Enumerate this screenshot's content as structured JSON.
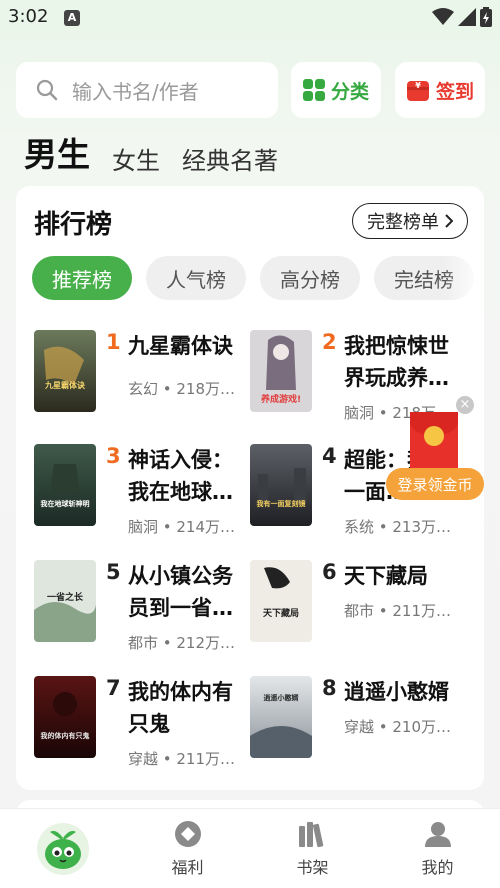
{
  "status_bar": {
    "time": "3:02",
    "notif_letter": "A"
  },
  "search": {
    "placeholder": "输入书名/作者"
  },
  "top_buttons": {
    "category": "分类",
    "signin": "签到"
  },
  "gender_tabs": [
    {
      "label": "男生",
      "active": true
    },
    {
      "label": "女生",
      "active": false
    },
    {
      "label": "经典名著",
      "active": false
    }
  ],
  "ranking": {
    "title": "排行榜",
    "full_list": "完整榜单",
    "chips": [
      {
        "label": "推荐榜",
        "active": true
      },
      {
        "label": "人气榜",
        "active": false
      },
      {
        "label": "高分榜",
        "active": false
      },
      {
        "label": "完结榜",
        "active": false
      }
    ],
    "books": [
      {
        "rank": "1",
        "title": "九星霸体诀",
        "meta": "玄幻 • 218万…"
      },
      {
        "rank": "2",
        "title": "我把惊悚世界玩成养…",
        "meta": "脑洞 • 218万…"
      },
      {
        "rank": "3",
        "title": "神话入侵：我在地球…",
        "meta": "脑洞 • 214万…"
      },
      {
        "rank": "4",
        "title": "超能：我有一面…",
        "meta": "系统 • 213万…"
      },
      {
        "rank": "5",
        "title": "从小镇公务员到一省…",
        "meta": "都市 • 212万…"
      },
      {
        "rank": "6",
        "title": "天下藏局",
        "meta": "都市 • 211万…"
      },
      {
        "rank": "7",
        "title": "我的体内有只鬼",
        "meta": "穿越 • 211万…"
      },
      {
        "rank": "8",
        "title": "逍遥小憨婿",
        "meta": "穿越 • 210万…"
      }
    ],
    "cover_texts": [
      "九星霸体诀",
      "养成游戏!",
      "我在地球斩神明",
      "我有一面复刻镜",
      "一省之长",
      "天下藏局",
      "我的体内有只鬼",
      "逍遥小憨婿"
    ]
  },
  "floating": {
    "close": "×",
    "label": "登录领金币"
  },
  "bottom_nav": [
    {
      "label": "",
      "icon": "mascot-icon"
    },
    {
      "label": "福利",
      "icon": "welfare-icon"
    },
    {
      "label": "书架",
      "icon": "bookshelf-icon"
    },
    {
      "label": "我的",
      "icon": "profile-icon"
    }
  ],
  "colors": {
    "accent_green": "#47b04a",
    "rank_orange": "#f06a1f",
    "signin_red": "#e93a2f",
    "coin_orange": "#f6a23a"
  }
}
